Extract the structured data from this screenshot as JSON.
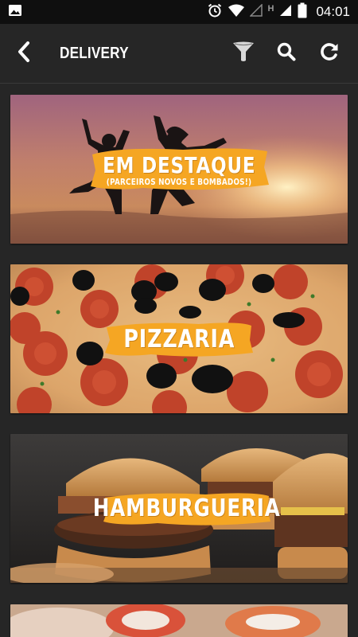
{
  "status_bar": {
    "time": "04:01",
    "network_label": "H"
  },
  "app_bar": {
    "title": "DELIVERY"
  },
  "categories": [
    {
      "title": "EM DESTAQUE",
      "subtitle": "(PARCEIROS NOVOS E BOMBADOS!)"
    },
    {
      "title": "PIZZARIA"
    },
    {
      "title": "HAMBURGUERIA"
    }
  ],
  "colors": {
    "background": "#262626",
    "status_bar": "#0f0f0f",
    "accent_brush": "#f5a623",
    "text": "#ffffff"
  }
}
